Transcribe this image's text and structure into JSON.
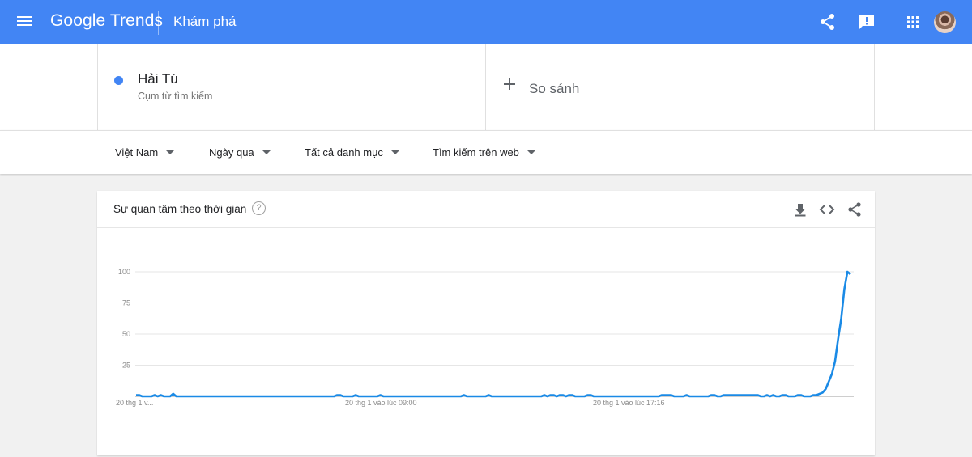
{
  "header": {
    "logo_google": "Google",
    "logo_trends": "Trends",
    "page_title": "Khám phá",
    "icons": [
      "menu-icon",
      "share-icon",
      "feedback-icon",
      "apps-icon",
      "avatar"
    ],
    "color": "#4285f4"
  },
  "search_term": {
    "name": "Hải Tú",
    "type": "Cụm từ tìm kiếm",
    "dot_color": "#4285f4"
  },
  "compare": {
    "label": "So sánh"
  },
  "filters": [
    {
      "label": "Việt Nam"
    },
    {
      "label": "Ngày qua"
    },
    {
      "label": "Tất cả danh mục"
    },
    {
      "label": "Tìm kiếm trên web"
    }
  ],
  "card": {
    "title": "Sự quan tâm theo thời gian",
    "help_symbol": "?",
    "icons": [
      "download-icon",
      "embed-icon",
      "share-icon"
    ]
  },
  "chart_data": {
    "type": "line",
    "series": [
      {
        "color": "#1a8ae6",
        "values": [
          1,
          1,
          0,
          0,
          0,
          0,
          1,
          0,
          1,
          0,
          0,
          0,
          2,
          0,
          0,
          0,
          0,
          0,
          0,
          0,
          0,
          0,
          0,
          0,
          0,
          0,
          0,
          0,
          0,
          0,
          0,
          0,
          0,
          0,
          0,
          0,
          0,
          0,
          0,
          0,
          0,
          0,
          0,
          0,
          0,
          0,
          0,
          0,
          0,
          0,
          0,
          0,
          0,
          0,
          0,
          0,
          0,
          0,
          0,
          0,
          0,
          0,
          0,
          0,
          0,
          1,
          1,
          0,
          0,
          0,
          0,
          1,
          0,
          0,
          0,
          0,
          0,
          0,
          0,
          1,
          0,
          0,
          0,
          0,
          0,
          0,
          0,
          0,
          0,
          0,
          0,
          0,
          0,
          0,
          0,
          0,
          0,
          0,
          0,
          0,
          0,
          0,
          0,
          0,
          0,
          0,
          1,
          0,
          0,
          0,
          0,
          0,
          0,
          0,
          1,
          0,
          0,
          0,
          0,
          0,
          0,
          0,
          0,
          0,
          0,
          0,
          0,
          0,
          0,
          0,
          0,
          0,
          1,
          0,
          1,
          1,
          0,
          1,
          1,
          0,
          1,
          1,
          0,
          0,
          0,
          0,
          1,
          1,
          0,
          0,
          0,
          0,
          0,
          0,
          0,
          0,
          0,
          0,
          0,
          0,
          0,
          0,
          0,
          0,
          0,
          0,
          0,
          0,
          0,
          0,
          1,
          1,
          1,
          1,
          0,
          0,
          0,
          0,
          1,
          0,
          0,
          0,
          0,
          0,
          0,
          0,
          1,
          1,
          0,
          0,
          1,
          1,
          1,
          1,
          1,
          1,
          1,
          1,
          1,
          1,
          1,
          1,
          0,
          0,
          1,
          0,
          1,
          0,
          0,
          1,
          1,
          0,
          0,
          0,
          1,
          1,
          0,
          0,
          0,
          1,
          1,
          2,
          3,
          6,
          12,
          18,
          28,
          46,
          62,
          86,
          100,
          98
        ]
      }
    ],
    "x_tick_labels": [
      "20 thg 1 v...",
      "20 thg 1 vào lúc 09:00",
      "20 thg 1 vào lúc 17:16"
    ],
    "y_ticks": [
      25,
      50,
      75,
      100
    ],
    "ylim": [
      0,
      100
    ],
    "grid": true
  }
}
